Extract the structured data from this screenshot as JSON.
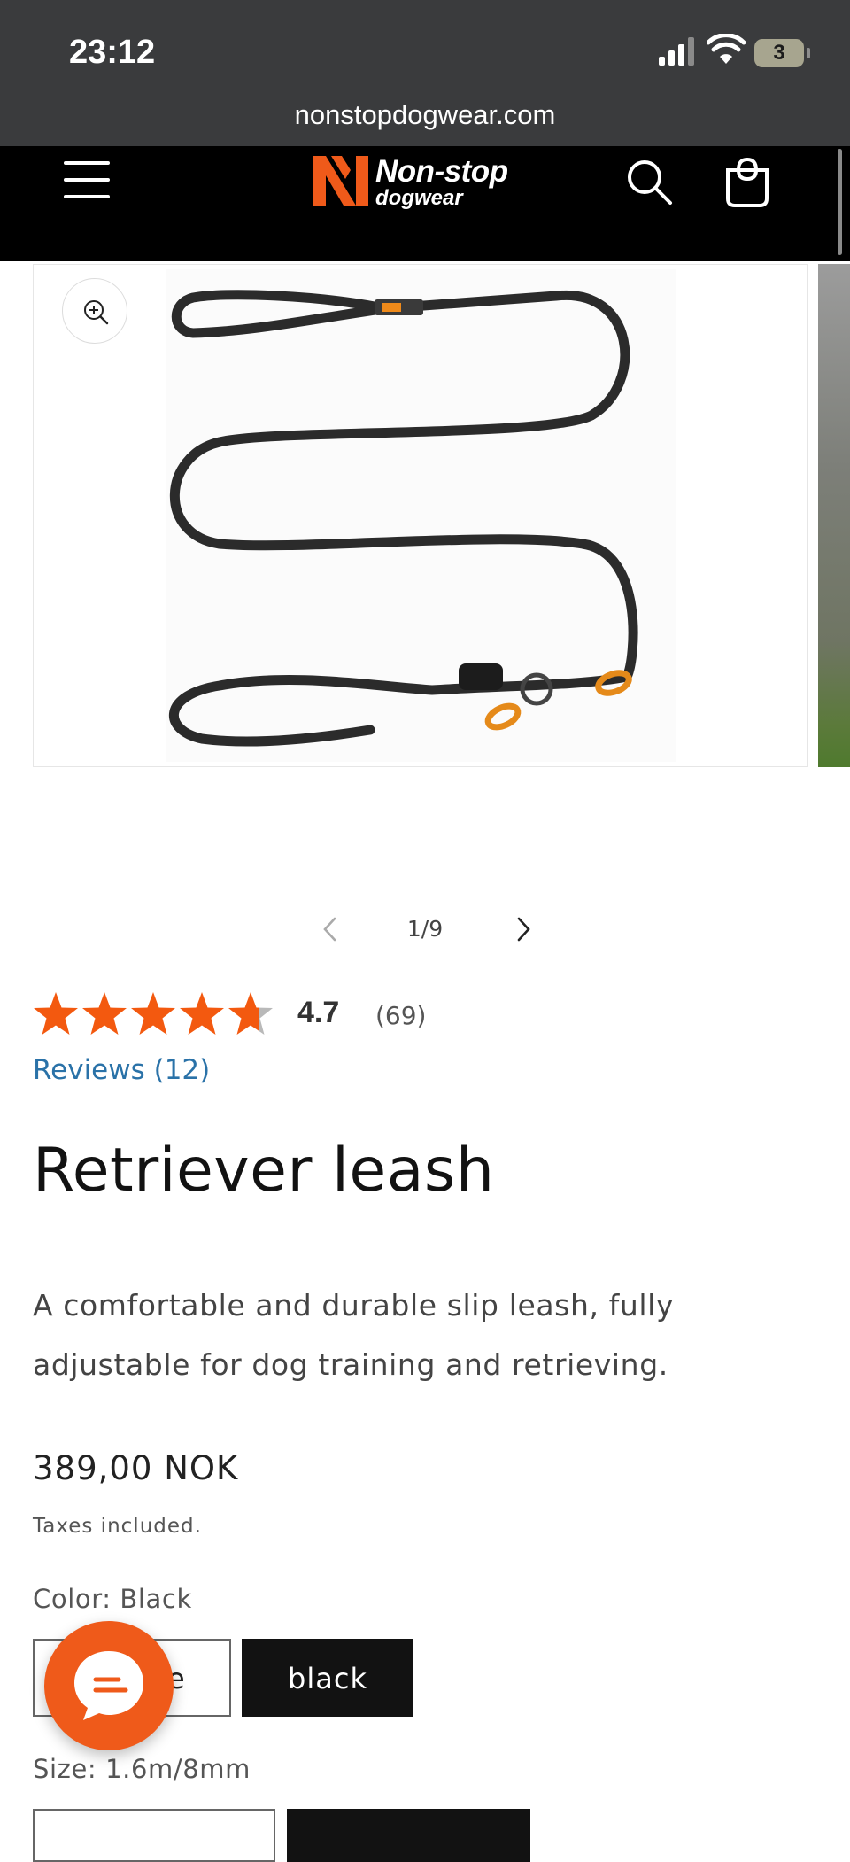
{
  "status_bar": {
    "time": "23:12",
    "battery": "3",
    "url": "nonstopdogwear.com"
  },
  "header": {
    "logo_line1": "Non-stop",
    "logo_line2": "dogwear",
    "logo_registered": "®"
  },
  "gallery": {
    "counter": "1/9"
  },
  "rating": {
    "stars_value": 4.7,
    "value": "4.7",
    "count": "(69)",
    "reviews_link": "Reviews (12)"
  },
  "product": {
    "title": "Retriever leash",
    "description": "A comfortable and durable slip leash, fully adjustable for dog training and retrieving.",
    "price": "389,00 NOK",
    "taxes": "Taxes included.",
    "color_label": "Color: Black",
    "color_options": [
      "e",
      "black"
    ],
    "size_label": "Size: 1.6m/8mm"
  },
  "colors": {
    "accent": "#ef5a1a",
    "link": "#2a72a8",
    "header_bg": "#000000",
    "status_bg": "#3a3b3d"
  }
}
